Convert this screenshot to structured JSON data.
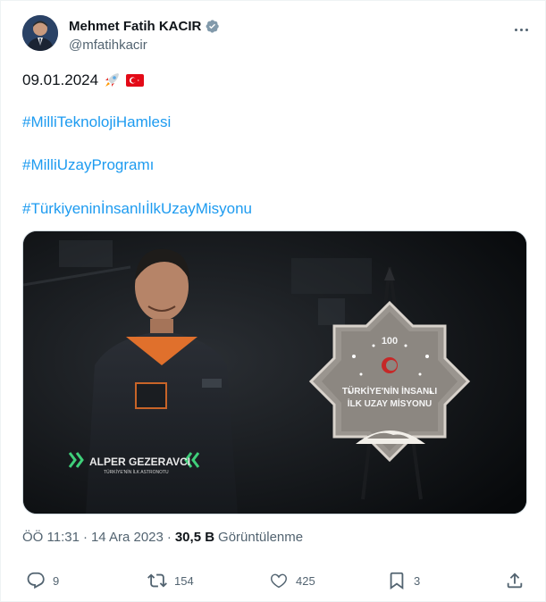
{
  "author": {
    "name": "Mehmet Fatih KACIR",
    "handle": "@mfatihkacir"
  },
  "tweet": {
    "date_text": "09.01.2024",
    "emojis": [
      "rocket-icon",
      "turkey-flag-icon"
    ],
    "hashtags": [
      "#MilliTeknolojiHamlesi",
      "#MilliUzayProgramı",
      "#TürkiyeninİnsanlıİlkUzayMisyonu"
    ]
  },
  "media": {
    "lower_third_name": "ALPER GEZERAVCI",
    "lower_third_title": "TÜRKİYE'NİN İLK ASTRONOTU",
    "emblem_number": "100",
    "emblem_line1": "TÜRKİYE'NİN İNSANLI",
    "emblem_line2": "İLK UZAY MİSYONU"
  },
  "meta": {
    "time": "ÖÖ 11:31",
    "separator": "·",
    "date": "14 Ara 2023",
    "separator2": "·",
    "views_count": "30,5 B",
    "views_label": "Görüntülenme"
  },
  "actions": {
    "replies": "9",
    "retweets": "154",
    "likes": "425",
    "bookmarks": "3"
  },
  "colors": {
    "link": "#1d9bf0",
    "secondary_text": "#536471",
    "primary_text": "#0f1419",
    "verified": "#829aab"
  }
}
